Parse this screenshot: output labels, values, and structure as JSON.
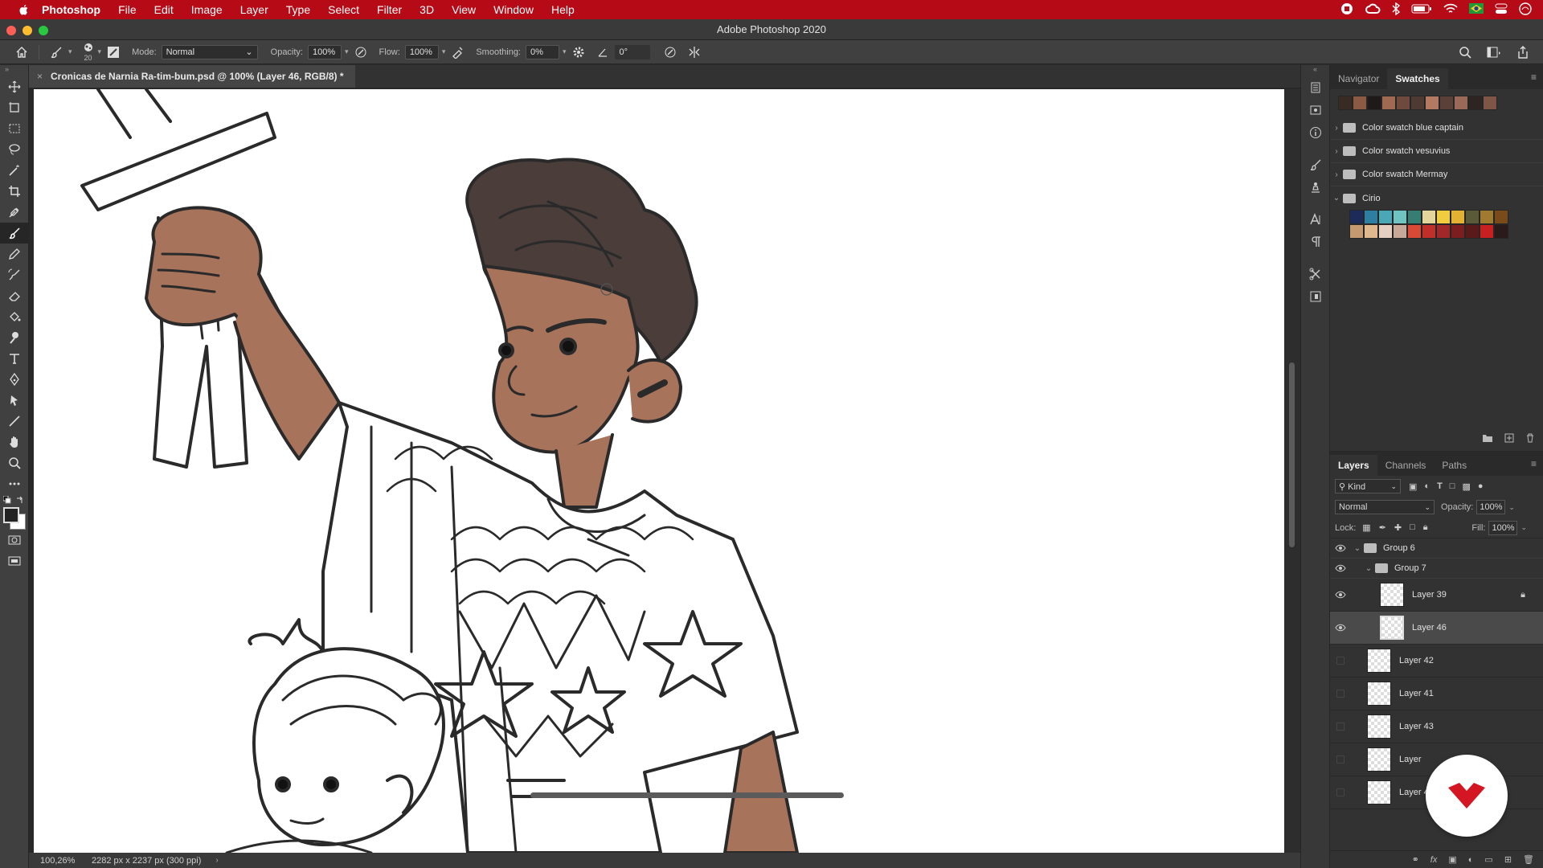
{
  "menubar": {
    "items": [
      "Photoshop",
      "File",
      "Edit",
      "Image",
      "Layer",
      "Type",
      "Select",
      "Filter",
      "3D",
      "View",
      "Window",
      "Help"
    ]
  },
  "window": {
    "title": "Adobe Photoshop 2020"
  },
  "options": {
    "brush_size": "20",
    "mode_label": "Mode:",
    "mode_value": "Normal",
    "opacity_label": "Opacity:",
    "opacity_value": "100%",
    "flow_label": "Flow:",
    "flow_value": "100%",
    "smoothing_label": "Smoothing:",
    "smoothing_value": "0%",
    "angle_value": "0°"
  },
  "document": {
    "tab_title": "Cronicas de Narnia Ra-tim-bum.psd @ 100% (Layer 46, RGB/8) *",
    "zoom": "100,26%",
    "dimensions": "2282 px x 2237 px (300 ppi)"
  },
  "swatches_panel": {
    "tabs": [
      "Navigator",
      "Swatches"
    ],
    "recent_colors": [
      "#3a2a24",
      "#8c5a44",
      "#1e1a18",
      "#a06a52",
      "#6d4a3c",
      "#4c3a33",
      "#b27a62",
      "#5a4038",
      "#9a6a58",
      "#2e2522",
      "#7e5648"
    ],
    "groups": [
      {
        "name": "Color swatch blue captain",
        "expanded": false
      },
      {
        "name": "Color swatch vesuvius",
        "expanded": false
      },
      {
        "name": "Color swatch Mermay",
        "expanded": false
      },
      {
        "name": "Cirio",
        "expanded": true
      }
    ],
    "cirio_row1": [
      "#1d2b5a",
      "#2e7ea2",
      "#49a7b6",
      "#6fc3c0",
      "#367d74",
      "#e4d69a",
      "#f0cc3e",
      "#e3b232",
      "#5a5a38",
      "#a07a2e",
      "#7a4a18"
    ],
    "cirio_row2": [
      "#c69a70",
      "#e0b890",
      "#e4d0c0",
      "#c8a898",
      "#d84a36",
      "#c03028",
      "#a02828",
      "#7a1e1e",
      "#5a1a1a",
      "#c82020",
      "#2a1a1a"
    ]
  },
  "layers_panel": {
    "tabs": [
      "Layers",
      "Channels",
      "Paths"
    ],
    "filter_label": "Kind",
    "blend_mode": "Normal",
    "opacity_label": "Opacity:",
    "opacity_value": "100%",
    "lock_label": "Lock:",
    "fill_label": "Fill:",
    "fill_value": "100%",
    "items": [
      {
        "name": "Group 6",
        "type": "group",
        "visible": true
      },
      {
        "name": "Group 7",
        "type": "group",
        "visible": true
      },
      {
        "name": "Layer 39",
        "type": "layer",
        "visible": true,
        "locked": true
      },
      {
        "name": "Layer 46",
        "type": "layer",
        "visible": true,
        "selected": true
      },
      {
        "name": "Layer 42",
        "type": "layer",
        "visible": false
      },
      {
        "name": "Layer 41",
        "type": "layer",
        "visible": false
      },
      {
        "name": "Layer 43",
        "type": "layer",
        "visible": false
      },
      {
        "name": "Layer",
        "type": "layer",
        "visible": false
      },
      {
        "name": "Layer 4",
        "type": "layer",
        "visible": false
      }
    ]
  },
  "colors": {
    "menubar": "#b60a16",
    "skin": "#a8735b",
    "hair": "#4a3d3a",
    "badge_logo": "#d41622"
  }
}
